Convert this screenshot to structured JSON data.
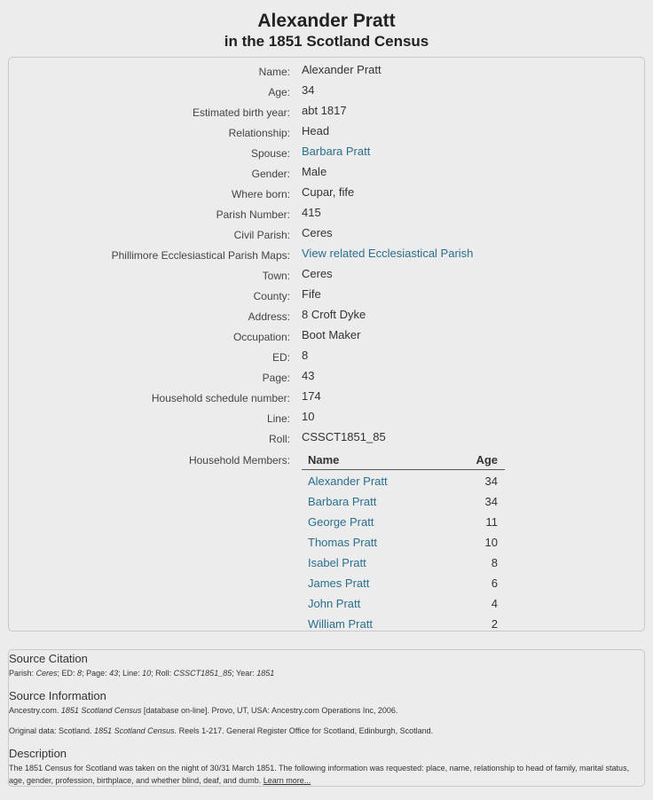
{
  "header": {
    "name": "Alexander Pratt",
    "subtitle": "in the 1851 Scotland Census"
  },
  "fields": [
    {
      "label": "Name:",
      "value": "Alexander Pratt",
      "link": false
    },
    {
      "label": "Age:",
      "value": "34",
      "link": false
    },
    {
      "label": "Estimated birth year:",
      "value": "abt 1817",
      "link": false
    },
    {
      "label": "Relationship:",
      "value": "Head",
      "link": false
    },
    {
      "label": "Spouse:",
      "value": "Barbara Pratt",
      "link": true
    },
    {
      "label": "Gender:",
      "value": "Male",
      "link": false
    },
    {
      "label": "Where born:",
      "value": "Cupar, fife",
      "link": false
    },
    {
      "label": "Parish Number:",
      "value": "415",
      "link": false
    },
    {
      "label": "Civil Parish:",
      "value": "Ceres",
      "link": false
    },
    {
      "label": "Phillimore Ecclesiastical Parish Maps:",
      "value": "View related Ecclesiastical Parish",
      "link": true
    },
    {
      "label": "Town:",
      "value": "Ceres",
      "link": false
    },
    {
      "label": "County:",
      "value": "Fife",
      "link": false
    },
    {
      "label": "Address:",
      "value": "8 Croft Dyke",
      "link": false
    },
    {
      "label": "Occupation:",
      "value": "Boot Maker",
      "link": false
    },
    {
      "label": "ED:",
      "value": "8",
      "link": false
    },
    {
      "label": "Page:",
      "value": "43",
      "link": false
    },
    {
      "label": "Household schedule number:",
      "value": "174",
      "link": false
    },
    {
      "label": "Line:",
      "value": "10",
      "link": false
    },
    {
      "label": "Roll:",
      "value": "CSSCT1851_85",
      "link": false
    }
  ],
  "household": {
    "label": "Household Members:",
    "col_name": "Name",
    "col_age": "Age",
    "members": [
      {
        "name": "Alexander Pratt",
        "age": "34"
      },
      {
        "name": "Barbara Pratt",
        "age": "34"
      },
      {
        "name": "George Pratt",
        "age": "11"
      },
      {
        "name": "Thomas Pratt",
        "age": "10"
      },
      {
        "name": "Isabel Pratt",
        "age": "8"
      },
      {
        "name": "James Pratt",
        "age": "6"
      },
      {
        "name": "John Pratt",
        "age": "4"
      },
      {
        "name": "William Pratt",
        "age": "2"
      }
    ]
  },
  "source": {
    "citation_title": "Source Citation",
    "citation": {
      "p1": "Parish: ",
      "parish": "Ceres",
      "p2": "; ED: ",
      "ed": "8",
      "p3": "; Page: ",
      "page": "43",
      "p4": "; Line: ",
      "line": "10",
      "p5": "; Roll: ",
      "roll": "CSSCT1851_85",
      "p6": "; Year: ",
      "year": "1851"
    },
    "info_title": "Source Information",
    "info1": {
      "a": "Ancestry.com. ",
      "title": "1851 Scotland Census",
      "b": " [database on-line]. Provo, UT, USA: Ancestry.com Operations Inc, 2006."
    },
    "info2": {
      "a": "Original data: Scotland. ",
      "title": "1851 Scotland Census.",
      "b": " Reels 1-217. General Register Office for Scotland, Edinburgh, Scotland."
    },
    "desc_title": "Description",
    "desc_text": "The 1851 Census for Scotland was taken on the night of 30/31 March 1851. The following information was requested: place, name, relationship to head of family, marital status, age, gender, profession, birthplace, and whether blind, deaf, and dumb. ",
    "learn_more": "Learn more..."
  }
}
